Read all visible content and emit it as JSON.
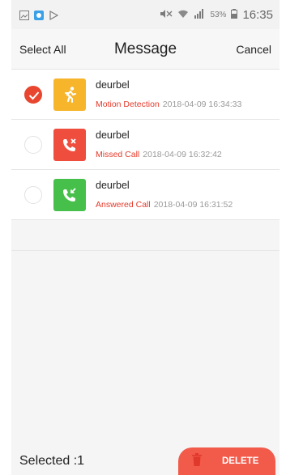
{
  "status_bar": {
    "battery_text": "53%",
    "time": "16:35"
  },
  "header": {
    "select_all": "Select All",
    "title": "Message",
    "cancel": "Cancel"
  },
  "messages": [
    {
      "device": "deurbel",
      "event": "Motion Detection",
      "timestamp": "2018-04-09 16:34:33",
      "selected": true,
      "icon": "motion-icon",
      "color": "#f7b52c"
    },
    {
      "device": "deurbel",
      "event": "Missed Call",
      "timestamp": "2018-04-09 16:32:42",
      "selected": false,
      "icon": "missed-call-icon",
      "color": "#ef4e3f"
    },
    {
      "device": "deurbel",
      "event": "Answered Call",
      "timestamp": "2018-04-09 16:31:52",
      "selected": false,
      "icon": "answered-call-icon",
      "color": "#47c04b"
    }
  ],
  "footer": {
    "selected_count": "Selected :1",
    "delete_label": "DELETE"
  },
  "colors": {
    "accent": "#e8462e",
    "event_text": "#e53a2a",
    "delete_button": "#f25a4a"
  }
}
